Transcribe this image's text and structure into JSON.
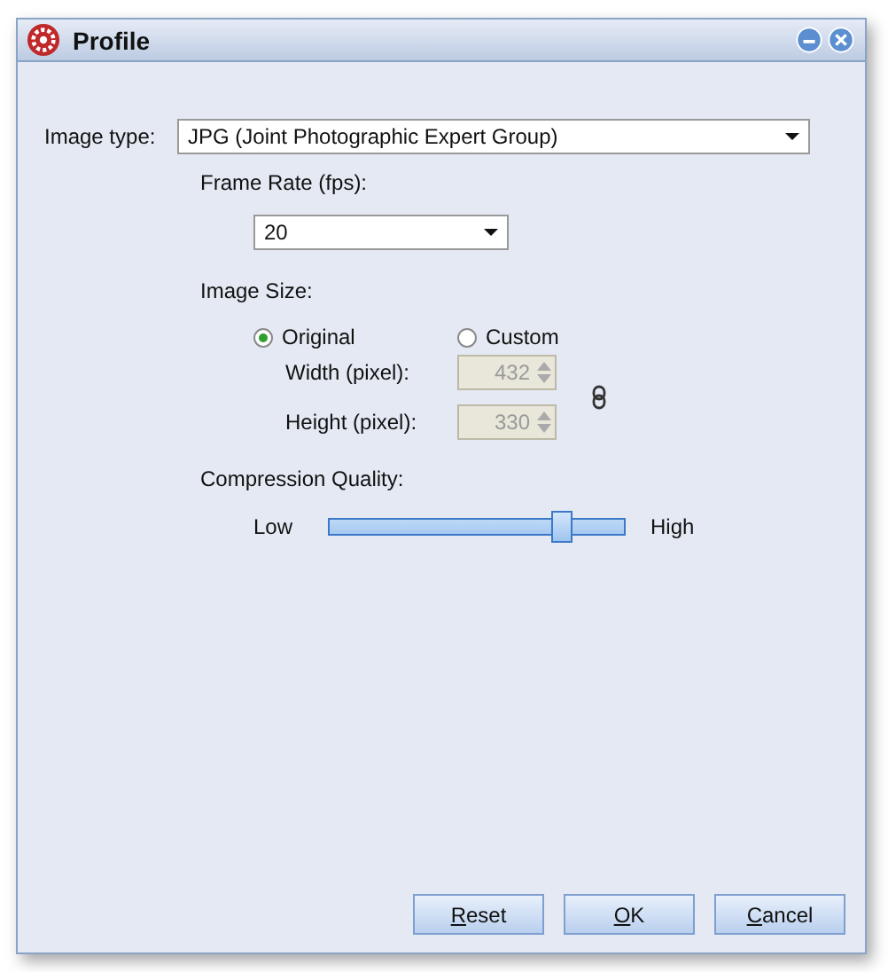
{
  "window": {
    "title": "Profile"
  },
  "image_type": {
    "label": "Image type:",
    "value": "JPG (Joint Photographic Expert Group)"
  },
  "frame_rate": {
    "label": "Frame Rate (fps):",
    "value": "20"
  },
  "image_size": {
    "label": "Image Size:",
    "options": [
      {
        "label": "Original",
        "selected": true
      },
      {
        "label": "Custom",
        "selected": false
      }
    ],
    "width": {
      "label": "Width (pixel):",
      "value": "432",
      "disabled": true
    },
    "height": {
      "label": "Height (pixel):",
      "value": "330",
      "disabled": true
    }
  },
  "compression": {
    "label": "Compression Quality:",
    "low": "Low",
    "high": "High",
    "level": 0.79
  },
  "buttons": [
    "Reset",
    "OK",
    "Cancel"
  ]
}
